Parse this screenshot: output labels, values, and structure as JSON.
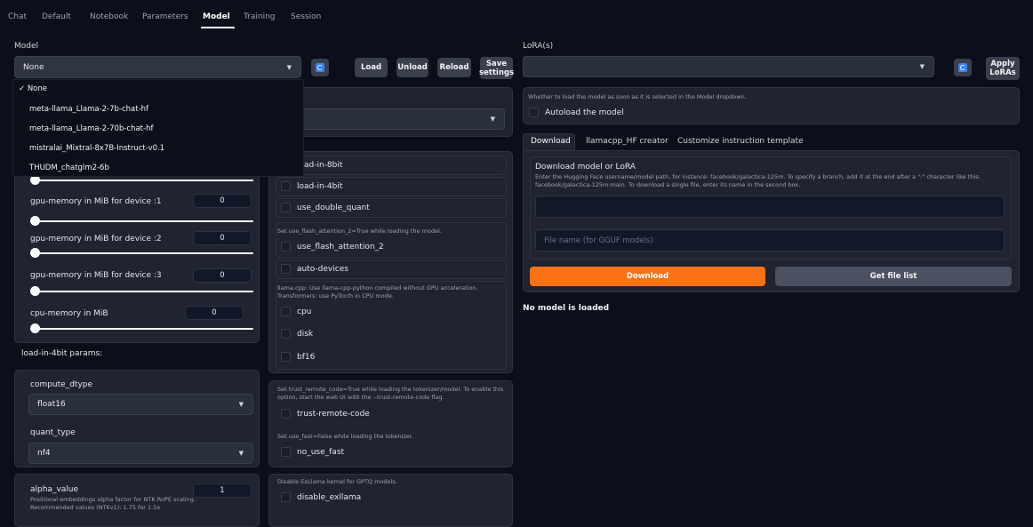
{
  "nav": {
    "tabs": [
      "Chat",
      "Default",
      "Notebook",
      "Parameters",
      "Model",
      "Training",
      "Session"
    ],
    "active": "Model"
  },
  "model": {
    "label": "Model",
    "selected": "None",
    "buttons": {
      "load": "Load",
      "unload": "Unload",
      "reload": "Reload",
      "save": "Save settings"
    },
    "options": [
      "✓ None",
      "meta-llama_Llama-2-7b-chat-hf",
      "meta-llama_Llama-2-70b-chat-hf",
      "mistralai_Mixtral-8x7B-Instruct-v0.1",
      "THUDM_chatglm2-6b"
    ]
  },
  "gpu": {
    "sliders": [
      {
        "label": "gpu-memory in MiB for device :1",
        "value": "0",
        "fraction": 0
      },
      {
        "label": "gpu-memory in MiB for device :2",
        "value": "0",
        "fraction": 0
      },
      {
        "label": "gpu-memory in MiB for device :3",
        "value": "0",
        "fraction": 0
      },
      {
        "label": "cpu-memory in MiB",
        "value": "0",
        "fraction": 0
      }
    ]
  },
  "load4bit": {
    "title": "load-in-4bit params:",
    "compute_dtype_label": "compute_dtype",
    "compute_dtype_value": "float16",
    "quant_type_label": "quant_type",
    "quant_type_value": "nf4"
  },
  "alpha": {
    "label": "alpha_value",
    "value": "1",
    "desc": "Positional embeddings alpha factor for NTK RoPE scaling. Recommended values (NTKv1): 1.75 for 1.5x"
  },
  "flags": {
    "load_8bit": "load-in-8bit",
    "load_4bit": "load-in-4bit",
    "double_quant": "use_double_quant",
    "flash_note": "Set use_flash_attention_2=True while loading the model.",
    "flash": "use_flash_attention_2",
    "auto_devices": "auto-devices",
    "cpu_note": "llama.cpp: Use llama-cpp-python compiled without GPU acceleration. Transformers: use PyTorch in CPU mode.",
    "cpu": "cpu",
    "disk": "disk",
    "bf16": "bf16",
    "trust_note": "Set trust_remote_code=True while loading the tokenizer/model. To enable this option, start the web UI with the --trust-remote-code flag.",
    "trust": "trust-remote-code",
    "fast_note": "Set use_fast=False while loading the tokenizer.",
    "fast": "no_use_fast",
    "exllama_note": "Disable ExLlama kernel for GPTQ models.",
    "exllama": "disable_exllama"
  },
  "lora": {
    "label": "LoRA(s)",
    "apply": "Apply LoRAs"
  },
  "autoload": {
    "note": "Whether to load the model as soon as it is selected in the Model dropdown.",
    "label": "Autoload the model"
  },
  "subtabs": {
    "items": [
      "Download",
      "llamacpp_HF creator",
      "Customize instruction template"
    ],
    "active": "Download"
  },
  "download": {
    "title": "Download model or LoRA",
    "desc": "Enter the Hugging Face username/model path, for instance: facebook/galactica-125m. To specify a branch, add it at the end after a \":\" character like this: facebook/galactica-125m:main. To download a single file, enter its name in the second box.",
    "filename_placeholder": "File name (for GGUF models)",
    "download_btn": "Download",
    "filelist_btn": "Get file list"
  },
  "status": "No model is loaded",
  "colors": {
    "background": "#0b0f19",
    "panel": "#1f2430",
    "accent_orange": "#f97316",
    "refresh_blue": "#3b82f6"
  }
}
